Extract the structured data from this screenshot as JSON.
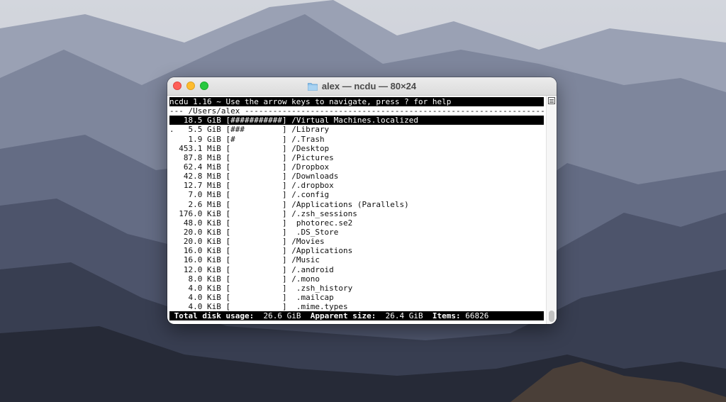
{
  "window": {
    "title": "alex — ncdu — 80×24",
    "folder_icon": "folder-icon"
  },
  "terminal": {
    "header": "ncdu 1.16 ~ Use the arrow keys to navigate, press ? for help",
    "path_line": "--- /Users/alex -----------------------------------------------------------------",
    "rows": [
      {
        "mark": " ",
        "size": "  18.5 GiB",
        "bar": "[###########]",
        "name": "/Virtual Machines.localized",
        "selected": true
      },
      {
        "mark": ".",
        "size": "   5.5 GiB",
        "bar": "[###        ]",
        "name": "/Library",
        "selected": false
      },
      {
        "mark": " ",
        "size": "   1.9 GiB",
        "bar": "[#          ]",
        "name": "/.Trash",
        "selected": false
      },
      {
        "mark": " ",
        "size": " 453.1 MiB",
        "bar": "[           ]",
        "name": "/Desktop",
        "selected": false
      },
      {
        "mark": " ",
        "size": "  87.8 MiB",
        "bar": "[           ]",
        "name": "/Pictures",
        "selected": false
      },
      {
        "mark": " ",
        "size": "  62.4 MiB",
        "bar": "[           ]",
        "name": "/Dropbox",
        "selected": false
      },
      {
        "mark": " ",
        "size": "  42.8 MiB",
        "bar": "[           ]",
        "name": "/Downloads",
        "selected": false
      },
      {
        "mark": " ",
        "size": "  12.7 MiB",
        "bar": "[           ]",
        "name": "/.dropbox",
        "selected": false
      },
      {
        "mark": " ",
        "size": "   7.0 MiB",
        "bar": "[           ]",
        "name": "/.config",
        "selected": false
      },
      {
        "mark": " ",
        "size": "   2.6 MiB",
        "bar": "[           ]",
        "name": "/Applications (Parallels)",
        "selected": false
      },
      {
        "mark": " ",
        "size": " 176.0 KiB",
        "bar": "[           ]",
        "name": "/.zsh_sessions",
        "selected": false
      },
      {
        "mark": " ",
        "size": "  48.0 KiB",
        "bar": "[           ]",
        "name": " photorec.se2",
        "selected": false
      },
      {
        "mark": " ",
        "size": "  20.0 KiB",
        "bar": "[           ]",
        "name": " .DS_Store",
        "selected": false
      },
      {
        "mark": " ",
        "size": "  20.0 KiB",
        "bar": "[           ]",
        "name": "/Movies",
        "selected": false
      },
      {
        "mark": " ",
        "size": "  16.0 KiB",
        "bar": "[           ]",
        "name": "/Applications",
        "selected": false
      },
      {
        "mark": " ",
        "size": "  16.0 KiB",
        "bar": "[           ]",
        "name": "/Music",
        "selected": false
      },
      {
        "mark": " ",
        "size": "  12.0 KiB",
        "bar": "[           ]",
        "name": "/.android",
        "selected": false
      },
      {
        "mark": " ",
        "size": "   8.0 KiB",
        "bar": "[           ]",
        "name": "/.mono",
        "selected": false
      },
      {
        "mark": " ",
        "size": "   4.0 KiB",
        "bar": "[           ]",
        "name": " .zsh_history",
        "selected": false
      },
      {
        "mark": " ",
        "size": "   4.0 KiB",
        "bar": "[           ]",
        "name": " .mailcap",
        "selected": false
      },
      {
        "mark": " ",
        "size": "   4.0 KiB",
        "bar": "[           ]",
        "name": " .mime.types",
        "selected": false
      }
    ],
    "status": {
      "total_label": " Total disk usage:",
      "total_value": "  26.6 GiB",
      "apparent_label": "  Apparent size:",
      "apparent_value": "  26.4 GiB",
      "items_label": "  Items:",
      "items_value": " 66826"
    }
  },
  "colors": {
    "close": "#fe5f57",
    "minimize": "#febc2e",
    "maximize": "#28c840",
    "terminal_bg": "#ffffff",
    "highlight_bg": "#000000"
  }
}
